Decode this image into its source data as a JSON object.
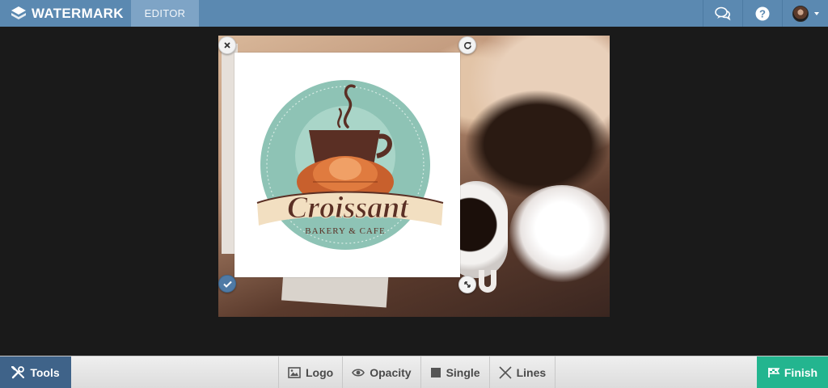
{
  "app": {
    "brand": "WATERMARK",
    "tab_editor": "EDITOR"
  },
  "header": {
    "icons": [
      "chat-bubbles-icon",
      "help-icon",
      "avatar",
      "caret-down-icon"
    ]
  },
  "canvas": {
    "logo": {
      "name_text": "Croissant",
      "tagline": "BAKERY & CAFE"
    },
    "handles": [
      "close-icon",
      "rotate-icon",
      "check-icon",
      "resize-icon"
    ]
  },
  "toolbar": {
    "tools_label": "Tools",
    "finish_label": "Finish",
    "items": [
      {
        "label": "Logo",
        "icon": "image-icon"
      },
      {
        "label": "Opacity",
        "icon": "eye-icon"
      },
      {
        "label": "Single",
        "icon": "square-icon"
      },
      {
        "label": "Lines",
        "icon": "cross-lines-icon"
      }
    ]
  },
  "colors": {
    "topbar": "#5b89b1",
    "tab_active": "#7ea4c6",
    "tools_button": "#3f6389",
    "finish_button": "#23b58f",
    "logo_teal": "#8ec3b5",
    "logo_brown": "#5a2f24",
    "logo_cream": "#f2dfc1"
  }
}
